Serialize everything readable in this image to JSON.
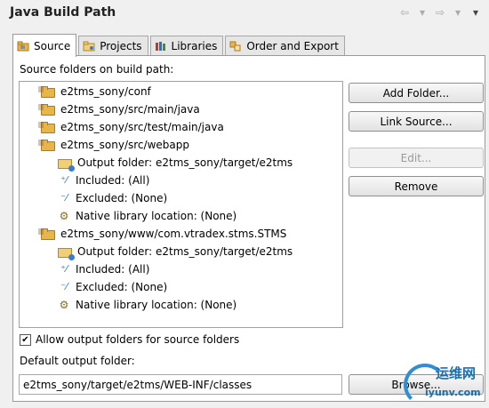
{
  "window": {
    "title": "Java Build Path"
  },
  "nav": {
    "back": "⇦",
    "back_menu": "▾",
    "forward": "⇨",
    "forward_menu": "▾",
    "view_menu": "▾"
  },
  "tabs": [
    {
      "label": "Source"
    },
    {
      "label": "Projects"
    },
    {
      "label": "Libraries"
    },
    {
      "label": "Order and Export"
    }
  ],
  "source": {
    "section_label": "Source folders on build path:",
    "tree": [
      {
        "type": "folder",
        "text": "e2tms_sony/conf"
      },
      {
        "type": "folder",
        "text": "e2tms_sony/src/main/java"
      },
      {
        "type": "folder",
        "text": "e2tms_sony/src/test/main/java"
      },
      {
        "type": "folder",
        "text": "e2tms_sony/src/webapp"
      },
      {
        "type": "output",
        "text": "Output folder: e2tms_sony/target/e2tms"
      },
      {
        "type": "included",
        "text": "Included: (All)"
      },
      {
        "type": "excluded",
        "text": "Excluded: (None)"
      },
      {
        "type": "native",
        "text": "Native library location: (None)"
      },
      {
        "type": "folder",
        "text": "e2tms_sony/www/com.vtradex.stms.STMS"
      },
      {
        "type": "output",
        "text": "Output folder: e2tms_sony/target/e2tms"
      },
      {
        "type": "included",
        "text": "Included: (All)"
      },
      {
        "type": "excluded",
        "text": "Excluded: (None)"
      },
      {
        "type": "native",
        "text": "Native library location: (None)"
      }
    ],
    "buttons": {
      "add_folder": "Add Folder...",
      "link_source": "Link Source...",
      "edit": "Edit...",
      "remove": "Remove"
    },
    "allow_output_label": "Allow output folders for source folders",
    "allow_output_checked": true,
    "default_output_label": "Default output folder:",
    "default_output_value": "e2tms_sony/target/e2tms/WEB-INF/classes",
    "browse_label": "Browse..."
  },
  "watermark": {
    "text_cn": "运维网",
    "url": "iyunv.com"
  }
}
